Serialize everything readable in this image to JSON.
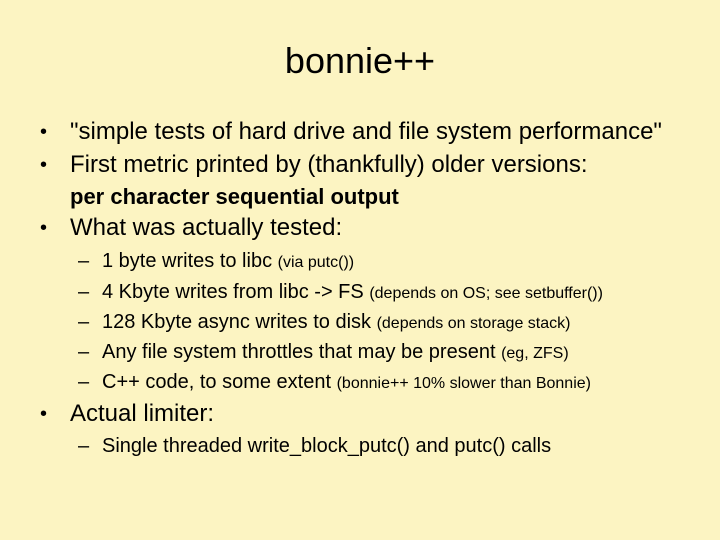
{
  "slide": {
    "title": "bonnie++",
    "bullets": [
      {
        "text": "\"simple tests of hard drive and file system performance\""
      },
      {
        "text": "First metric printed by (thankfully) older versions:",
        "bold_text": "per character sequential output"
      },
      {
        "text": "What was actually tested:",
        "sub": [
          {
            "text": "1 byte writes to libc",
            "note": "(via putc())"
          },
          {
            "text": "4 Kbyte writes from libc -> FS",
            "note": "(depends on OS; see setbuffer())"
          },
          {
            "text": "128 Kbyte async writes to disk",
            "note": "(depends on storage stack)"
          },
          {
            "text": "Any file system throttles that may be present",
            "note": "(eg, ZFS)"
          },
          {
            "text": "C++ code, to some extent",
            "note": "(bonnie++ 10% slower than Bonnie)"
          }
        ]
      },
      {
        "text": "Actual limiter:",
        "sub": [
          {
            "text": "Single threaded write_block_putc() and putc() calls",
            "note": ""
          }
        ]
      }
    ],
    "bullet_glyph": "•",
    "dash_glyph": "–"
  }
}
